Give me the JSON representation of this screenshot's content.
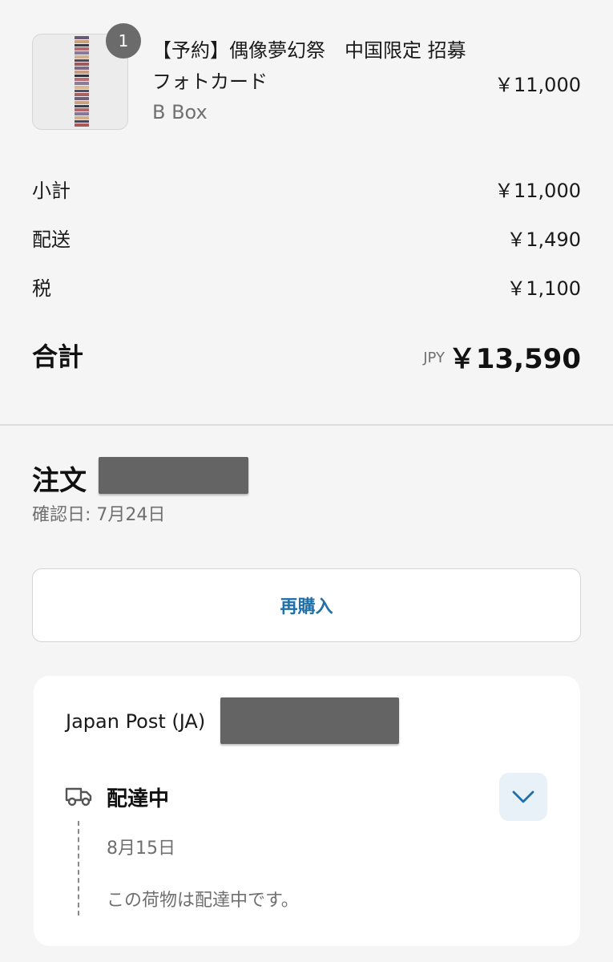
{
  "product": {
    "quantity": "1",
    "name": "【予約】偶像夢幻祭　中国限定 招募フォトカード",
    "variant": "B Box",
    "price": "￥11,000"
  },
  "summary": {
    "subtotal_label": "小計",
    "subtotal_value": "￥11,000",
    "shipping_label": "配送",
    "shipping_value": "￥1,490",
    "tax_label": "税",
    "tax_value": "￥1,100",
    "total_label": "合計",
    "currency": "JPY",
    "total_value": "￥13,590"
  },
  "order": {
    "title": "注文",
    "confirmed": "確認日: 7月24日",
    "rebuy_label": "再購入"
  },
  "shipment": {
    "carrier": "Japan Post (JA)",
    "status": "配達中",
    "date": "8月15日",
    "message": "この荷物は配達中です。"
  },
  "icons": {
    "truck": "delivery-truck-icon",
    "expand": "chevron-down-icon"
  },
  "colors": {
    "accent": "#1f6fa8",
    "redaction": "#646464",
    "badge": "#6b6b6b"
  }
}
